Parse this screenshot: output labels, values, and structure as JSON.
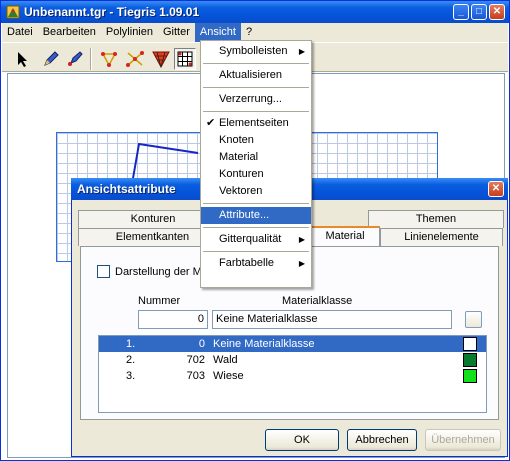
{
  "main_window": {
    "title": "Unbenannt.tgr - Tiegris 1.09.01",
    "menu": [
      "Datei",
      "Bearbeiten",
      "Polylinien",
      "Gitter",
      "Ansicht",
      "?"
    ],
    "active_menu": "Ansicht",
    "window_buttons": {
      "minimize": "_",
      "maximize": "□",
      "close": "✕"
    },
    "toolbar_icons": [
      "select-arrow-icon",
      "pen-icon",
      "node-pen-icon",
      "polygon-nodes-icon",
      "scatter-nodes-icon",
      "triangle-mesh-icon",
      "grid-cells-icon"
    ]
  },
  "ansicht_menu": {
    "items": [
      {
        "label": "Symbolleisten",
        "submenu": true
      },
      {
        "sep": true
      },
      {
        "label": "Aktualisieren"
      },
      {
        "sep": true
      },
      {
        "label": "Verzerrung..."
      },
      {
        "sep": true
      },
      {
        "label": "Elementseiten",
        "checked": true
      },
      {
        "label": "Knoten"
      },
      {
        "label": "Material"
      },
      {
        "label": "Konturen"
      },
      {
        "label": "Vektoren"
      },
      {
        "sep": true
      },
      {
        "label": "Attribute...",
        "highlighted": true
      },
      {
        "sep": true
      },
      {
        "label": "Gitterqualität",
        "submenu": true
      },
      {
        "sep": true
      },
      {
        "label": "Farbtabelle",
        "submenu": true
      }
    ]
  },
  "dialog": {
    "title": "Ansichtsattribute",
    "close_glyph": "✕",
    "tabs_back": [
      "Konturen",
      "Themen"
    ],
    "tabs_front": [
      "Elementkanten",
      "Material",
      "Linienelemente"
    ],
    "selected_tab": "Material",
    "checkbox_label": "Darstellung der M",
    "labels": {
      "nummer": "Nummer",
      "materialklasse": "Materialklasse"
    },
    "inputs": {
      "nummer": "0",
      "materialklasse": "Keine Materialklasse"
    },
    "materials": [
      {
        "index": "1.",
        "number": "0",
        "name": "Keine Materialklasse",
        "color": "#ffffff",
        "selected": true
      },
      {
        "index": "2.",
        "number": "702",
        "name": "Wald",
        "color": "#0a7a2e",
        "selected": false
      },
      {
        "index": "3.",
        "number": "703",
        "name": "Wiese",
        "color": "#11e01a",
        "selected": false
      }
    ],
    "buttons": {
      "ok": "OK",
      "cancel": "Abbrechen",
      "apply": "Übernehmen"
    }
  }
}
